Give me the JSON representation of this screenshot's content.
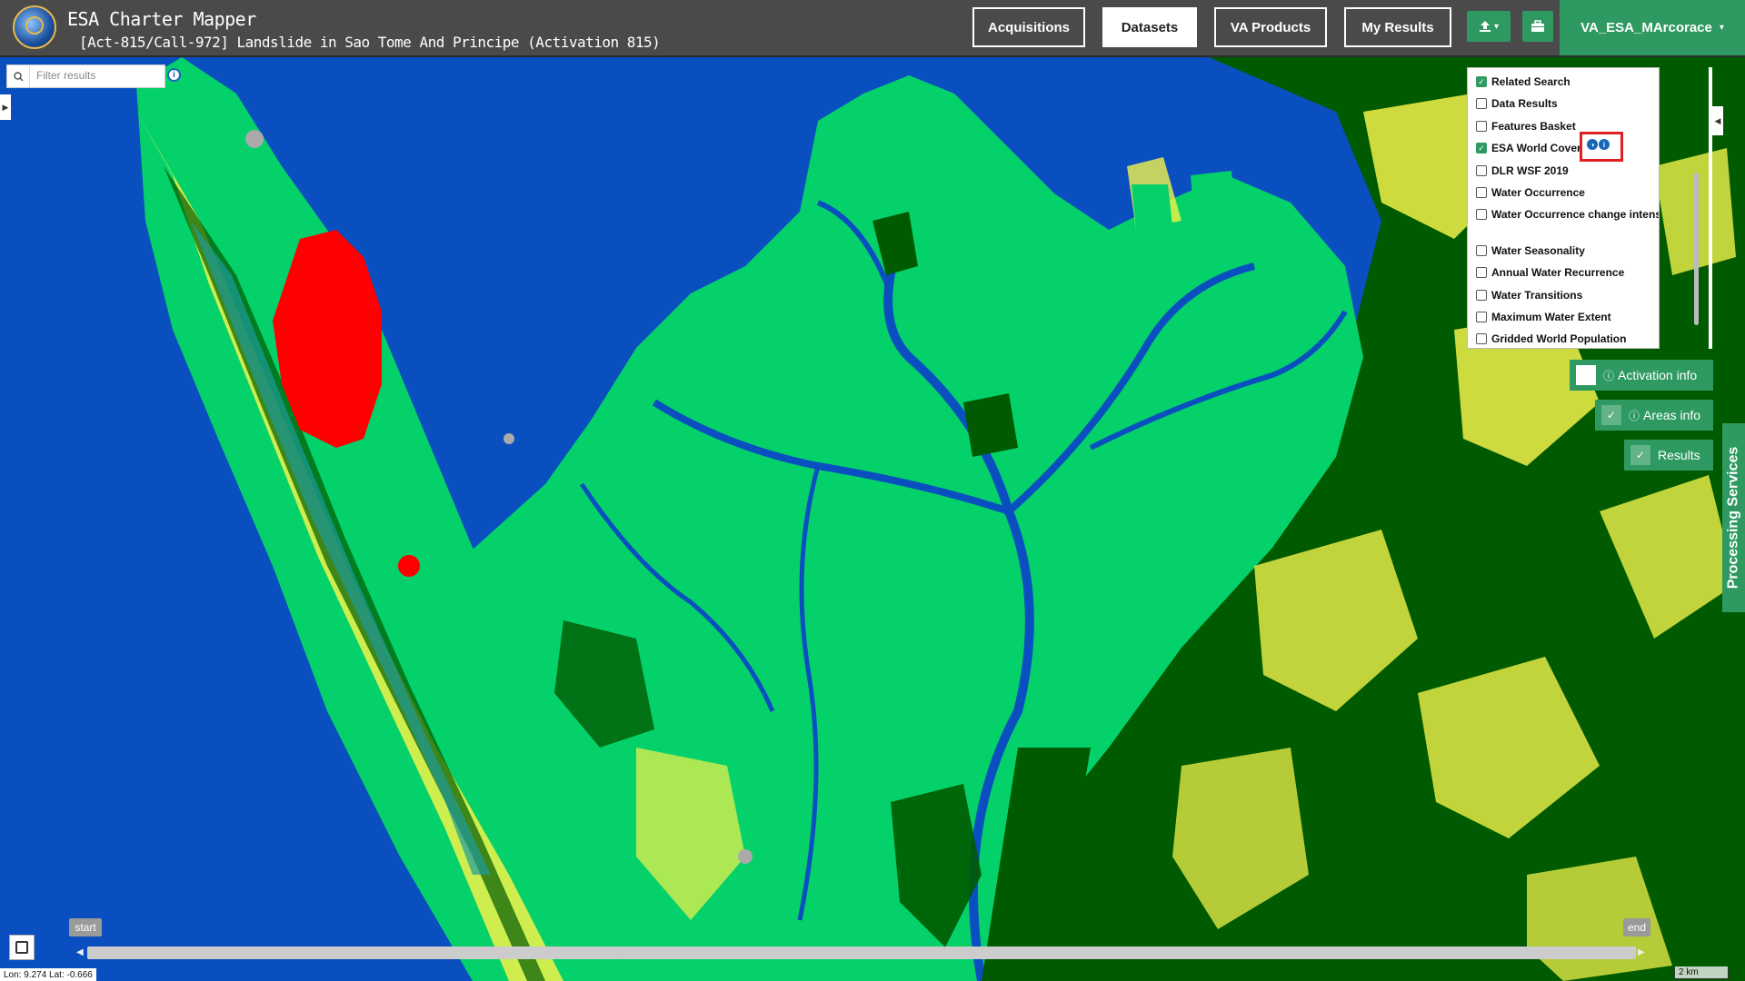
{
  "header": {
    "app_title": "ESA Charter Mapper",
    "activation_title": "[Act-815/Call-972] Landslide in Sao Tome And Principe (Activation 815)",
    "nav": [
      {
        "label": "Acquisitions",
        "active": false
      },
      {
        "label": "Datasets",
        "active": true
      },
      {
        "label": "VA Products",
        "active": false
      },
      {
        "label": "My Results",
        "active": false
      }
    ],
    "upload_icon": "upload-icon",
    "upload_caret": "▾",
    "briefcase_icon": "briefcase-icon",
    "user": "VA_ESA_MArcorace",
    "user_caret": "▾",
    "accent_color": "#2e9a61",
    "header_bg": "#4a4a4a"
  },
  "filter": {
    "placeholder": "Filter results",
    "value": ""
  },
  "layers": {
    "items": [
      {
        "label": "Related Search",
        "checked": true
      },
      {
        "label": "Data Results",
        "checked": false
      },
      {
        "label": "Features Basket",
        "checked": false
      },
      {
        "label": "ESA World Cover",
        "checked": true
      },
      {
        "label": "DLR WSF 2019",
        "checked": false
      },
      {
        "label": "Water Occurrence",
        "checked": false
      },
      {
        "label": "Water Occurrence change intensity",
        "checked": false
      },
      {
        "label": "Water Seasonality",
        "checked": false
      },
      {
        "label": "Annual Water Recurrence",
        "checked": false
      },
      {
        "label": "Water Transitions",
        "checked": false
      },
      {
        "label": "Maximum Water Extent",
        "checked": false
      },
      {
        "label": "Gridded World Population",
        "checked": false
      }
    ],
    "highlight_color": "#e02020"
  },
  "side_buttons": {
    "activation_info": "Activation info",
    "activation_checked": false,
    "areas_info": "Areas info",
    "areas_checked": true,
    "results": "Results",
    "results_checked": true,
    "processing_services": "Processing Services"
  },
  "timeline": {
    "start": "start",
    "end": "end"
  },
  "status": {
    "coords": "Lon: 9.274 Lat: -0.666",
    "scale": "2 km"
  },
  "map_colors": {
    "water": "#0a4fbf",
    "grassland": "#05d16a",
    "tree_cover": "#005a00",
    "cropland": "#f2f24a",
    "built_up": "#ff0000",
    "bare": "#aaaaaa",
    "wetland": "#1e9b9b"
  }
}
